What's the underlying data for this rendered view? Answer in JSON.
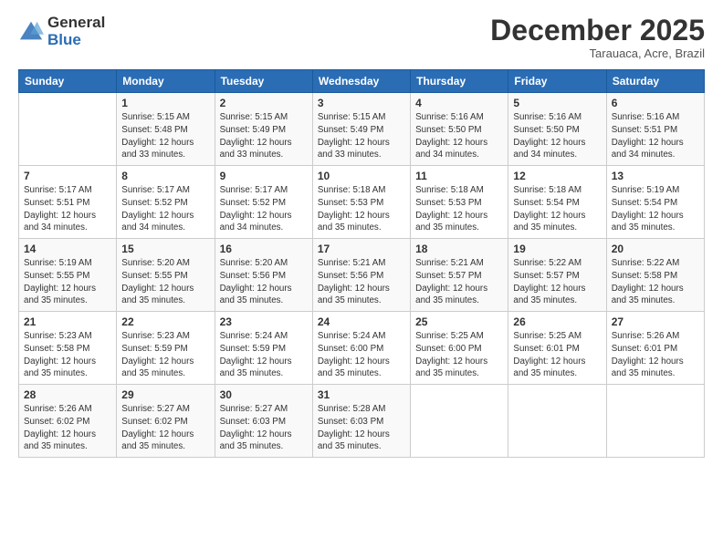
{
  "logo": {
    "general": "General",
    "blue": "Blue"
  },
  "title": "December 2025",
  "subtitle": "Tarauaca, Acre, Brazil",
  "days_of_week": [
    "Sunday",
    "Monday",
    "Tuesday",
    "Wednesday",
    "Thursday",
    "Friday",
    "Saturday"
  ],
  "weeks": [
    [
      {
        "day": "",
        "info": ""
      },
      {
        "day": "1",
        "info": "Sunrise: 5:15 AM\nSunset: 5:48 PM\nDaylight: 12 hours\nand 33 minutes."
      },
      {
        "day": "2",
        "info": "Sunrise: 5:15 AM\nSunset: 5:49 PM\nDaylight: 12 hours\nand 33 minutes."
      },
      {
        "day": "3",
        "info": "Sunrise: 5:15 AM\nSunset: 5:49 PM\nDaylight: 12 hours\nand 33 minutes."
      },
      {
        "day": "4",
        "info": "Sunrise: 5:16 AM\nSunset: 5:50 PM\nDaylight: 12 hours\nand 34 minutes."
      },
      {
        "day": "5",
        "info": "Sunrise: 5:16 AM\nSunset: 5:50 PM\nDaylight: 12 hours\nand 34 minutes."
      },
      {
        "day": "6",
        "info": "Sunrise: 5:16 AM\nSunset: 5:51 PM\nDaylight: 12 hours\nand 34 minutes."
      }
    ],
    [
      {
        "day": "7",
        "info": "Sunrise: 5:17 AM\nSunset: 5:51 PM\nDaylight: 12 hours\nand 34 minutes."
      },
      {
        "day": "8",
        "info": "Sunrise: 5:17 AM\nSunset: 5:52 PM\nDaylight: 12 hours\nand 34 minutes."
      },
      {
        "day": "9",
        "info": "Sunrise: 5:17 AM\nSunset: 5:52 PM\nDaylight: 12 hours\nand 34 minutes."
      },
      {
        "day": "10",
        "info": "Sunrise: 5:18 AM\nSunset: 5:53 PM\nDaylight: 12 hours\nand 35 minutes."
      },
      {
        "day": "11",
        "info": "Sunrise: 5:18 AM\nSunset: 5:53 PM\nDaylight: 12 hours\nand 35 minutes."
      },
      {
        "day": "12",
        "info": "Sunrise: 5:18 AM\nSunset: 5:54 PM\nDaylight: 12 hours\nand 35 minutes."
      },
      {
        "day": "13",
        "info": "Sunrise: 5:19 AM\nSunset: 5:54 PM\nDaylight: 12 hours\nand 35 minutes."
      }
    ],
    [
      {
        "day": "14",
        "info": "Sunrise: 5:19 AM\nSunset: 5:55 PM\nDaylight: 12 hours\nand 35 minutes."
      },
      {
        "day": "15",
        "info": "Sunrise: 5:20 AM\nSunset: 5:55 PM\nDaylight: 12 hours\nand 35 minutes."
      },
      {
        "day": "16",
        "info": "Sunrise: 5:20 AM\nSunset: 5:56 PM\nDaylight: 12 hours\nand 35 minutes."
      },
      {
        "day": "17",
        "info": "Sunrise: 5:21 AM\nSunset: 5:56 PM\nDaylight: 12 hours\nand 35 minutes."
      },
      {
        "day": "18",
        "info": "Sunrise: 5:21 AM\nSunset: 5:57 PM\nDaylight: 12 hours\nand 35 minutes."
      },
      {
        "day": "19",
        "info": "Sunrise: 5:22 AM\nSunset: 5:57 PM\nDaylight: 12 hours\nand 35 minutes."
      },
      {
        "day": "20",
        "info": "Sunrise: 5:22 AM\nSunset: 5:58 PM\nDaylight: 12 hours\nand 35 minutes."
      }
    ],
    [
      {
        "day": "21",
        "info": "Sunrise: 5:23 AM\nSunset: 5:58 PM\nDaylight: 12 hours\nand 35 minutes."
      },
      {
        "day": "22",
        "info": "Sunrise: 5:23 AM\nSunset: 5:59 PM\nDaylight: 12 hours\nand 35 minutes."
      },
      {
        "day": "23",
        "info": "Sunrise: 5:24 AM\nSunset: 5:59 PM\nDaylight: 12 hours\nand 35 minutes."
      },
      {
        "day": "24",
        "info": "Sunrise: 5:24 AM\nSunset: 6:00 PM\nDaylight: 12 hours\nand 35 minutes."
      },
      {
        "day": "25",
        "info": "Sunrise: 5:25 AM\nSunset: 6:00 PM\nDaylight: 12 hours\nand 35 minutes."
      },
      {
        "day": "26",
        "info": "Sunrise: 5:25 AM\nSunset: 6:01 PM\nDaylight: 12 hours\nand 35 minutes."
      },
      {
        "day": "27",
        "info": "Sunrise: 5:26 AM\nSunset: 6:01 PM\nDaylight: 12 hours\nand 35 minutes."
      }
    ],
    [
      {
        "day": "28",
        "info": "Sunrise: 5:26 AM\nSunset: 6:02 PM\nDaylight: 12 hours\nand 35 minutes."
      },
      {
        "day": "29",
        "info": "Sunrise: 5:27 AM\nSunset: 6:02 PM\nDaylight: 12 hours\nand 35 minutes."
      },
      {
        "day": "30",
        "info": "Sunrise: 5:27 AM\nSunset: 6:03 PM\nDaylight: 12 hours\nand 35 minutes."
      },
      {
        "day": "31",
        "info": "Sunrise: 5:28 AM\nSunset: 6:03 PM\nDaylight: 12 hours\nand 35 minutes."
      },
      {
        "day": "",
        "info": ""
      },
      {
        "day": "",
        "info": ""
      },
      {
        "day": "",
        "info": ""
      }
    ]
  ]
}
